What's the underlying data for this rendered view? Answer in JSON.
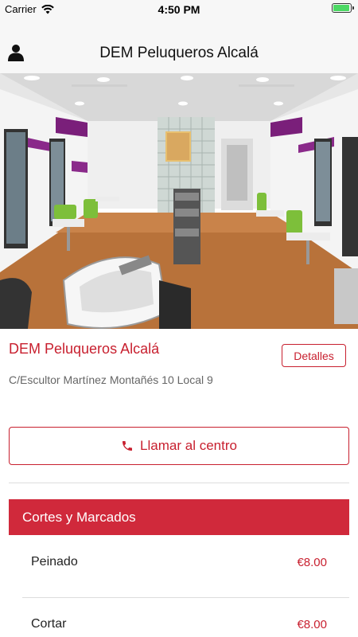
{
  "status_bar": {
    "carrier": "Carrier",
    "time": "4:50 PM",
    "battery_level": 0.95,
    "battery_color": "#4cd964"
  },
  "nav": {
    "title": "DEM Peluqueros Alcalá",
    "user_icon": "user-icon"
  },
  "salon": {
    "name": "DEM Peluqueros Alcalá",
    "details_label": "Detalles",
    "address": "C/Escultor Martínez Montañés 10 Local 9"
  },
  "call": {
    "label": "Llamar al centro",
    "icon": "phone-icon"
  },
  "section": {
    "title": "Cortes y Marcados",
    "color": "#d0293b"
  },
  "services": [
    {
      "name": "Peinado",
      "price": "€8.00"
    },
    {
      "name": "Cortar",
      "price": "€8.00"
    }
  ],
  "accent_color": "#c8202f"
}
